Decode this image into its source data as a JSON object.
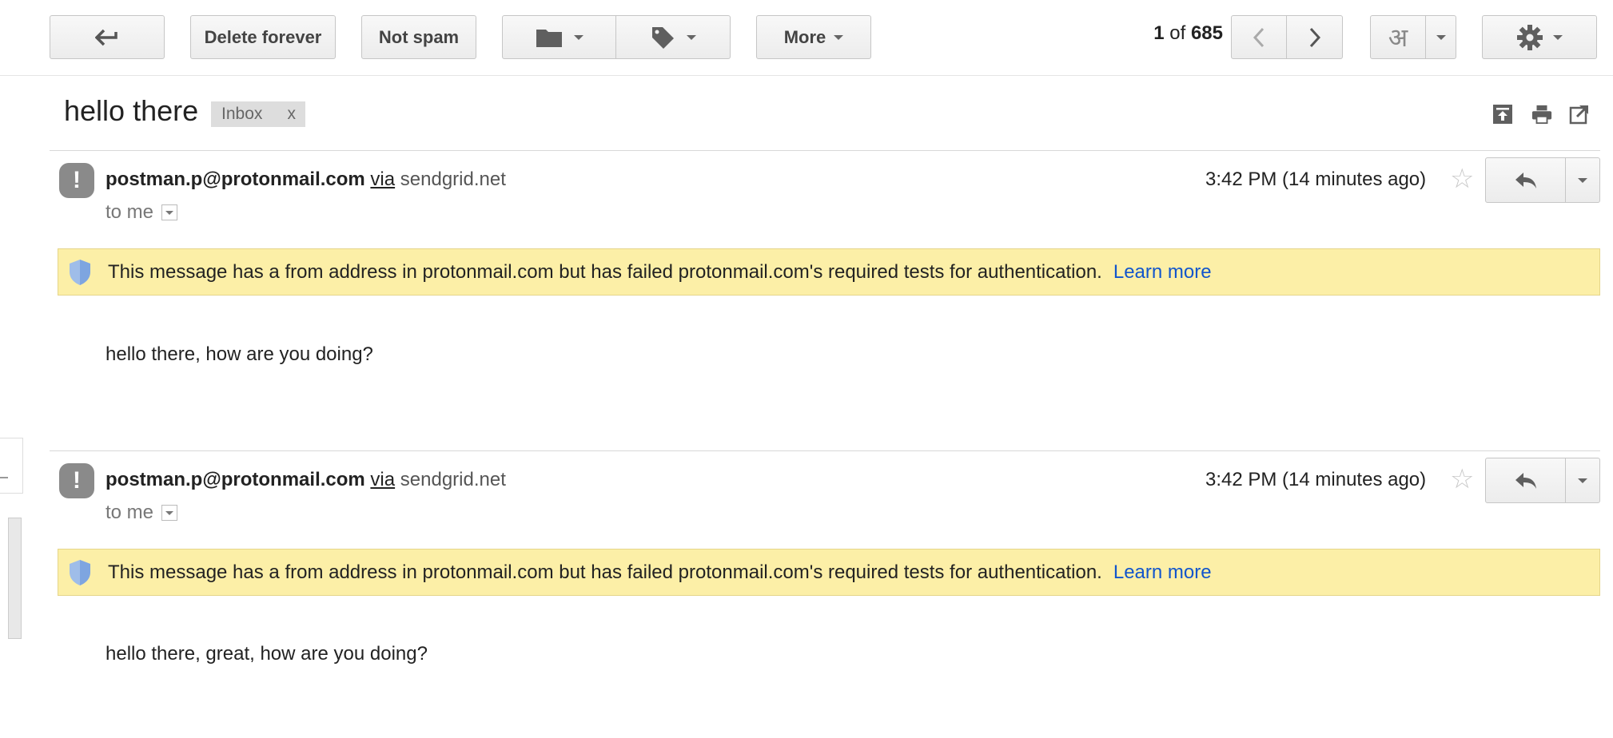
{
  "toolbar": {
    "back_icon": "back-arrow-icon",
    "delete_forever_label": "Delete forever",
    "not_spam_label": "Not spam",
    "folder_icon": "folder-icon",
    "tag_icon": "tag-icon",
    "more_label": "More",
    "pager": {
      "current": "1",
      "of_text": "of",
      "total": "685"
    },
    "input_tool_glyph": "अ",
    "settings_icon": "gear-icon"
  },
  "thread": {
    "subject": "hello there",
    "label": "Inbox",
    "label_remove": "x"
  },
  "messages": [
    {
      "sender_email": "postman.p@protonmail.com",
      "via_text": "via",
      "via_domain": "sendgrid.net",
      "recipient_text": "to me",
      "time": "3:42 PM (14 minutes ago)",
      "warning_text": "This message has a from address in protonmail.com but has failed protonmail.com's required tests for authentication.",
      "learn_more": "Learn more",
      "body": "hello there, how are you doing?"
    },
    {
      "sender_email": "postman.p@protonmail.com",
      "via_text": "via",
      "via_domain": "sendgrid.net",
      "recipient_text": "to me",
      "time": "3:42 PM (14 minutes ago)",
      "warning_text": "This message has a from address in protonmail.com but has failed protonmail.com's required tests for authentication.",
      "learn_more": "Learn more",
      "body": "hello there, great, how are you doing?"
    }
  ],
  "colors": {
    "warning_bg": "#fcefa7",
    "link": "#1155cc",
    "avatar": "#8a8a8a"
  }
}
